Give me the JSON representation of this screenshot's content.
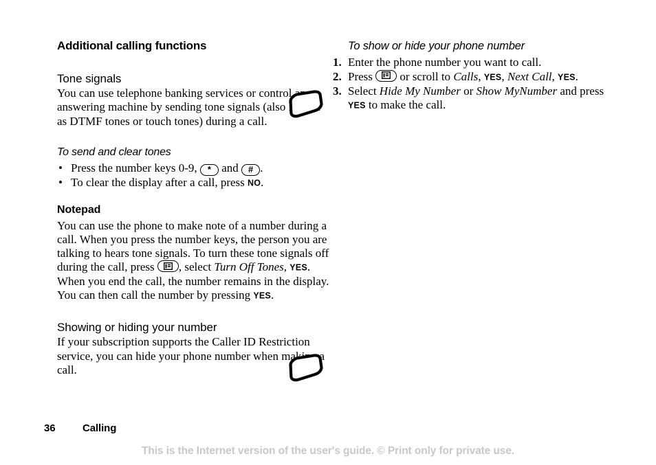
{
  "document": {
    "title": "Additional calling functions",
    "footer": {
      "page_number": "36",
      "chapter": "Calling"
    },
    "watermark": "This is the Internet version of the user's guide. © Print only for private use."
  },
  "left_column": {
    "tone_signals": {
      "heading": "Tone signals",
      "body": "You can use telephone banking services or control an answering machine by sending tone signals (also known as DTMF tones or touch tones) during a call."
    },
    "send_clear_tones": {
      "heading": "To send and clear tones",
      "bullets": [
        {
          "marker": "•",
          "part1": "Press the number keys 0-9,",
          "key1": "*",
          "part2": "and",
          "key2": "#",
          "part3": "."
        },
        {
          "marker": "•",
          "part1": "To clear the display after a call, press",
          "softkey": "NO",
          "part2": "."
        }
      ]
    },
    "notepad": {
      "heading": "Notepad",
      "part1": "You can use the phone to make note of a number during a call. When you press the number keys, the person you are talking to hears tone signals. To turn these tone signals off during the call, press",
      "part2": ", select",
      "menu_item": "Turn Off Tones",
      "part3": ",",
      "softkey1": "YES",
      "part4": ". When you end the call, the number remains in the display. You can then call the number by pressing",
      "softkey2": "YES",
      "part5": "."
    },
    "showing_hiding": {
      "heading": "Showing or hiding your number",
      "body": "If your subscription supports the Caller ID Restriction service, you can hide your phone number when making a call."
    }
  },
  "right_column": {
    "show_hide_number": {
      "heading": "To show or hide your phone number",
      "steps": [
        {
          "number": "1.",
          "part1": "Enter the phone number you want to call."
        },
        {
          "number": "2.",
          "part1": "Press",
          "part2": "or scroll to",
          "menu_item1": "Calls",
          "part3": ",",
          "softkey1": "YES",
          "part4": ",",
          "menu_item2": "Next Call",
          "part5": ",",
          "softkey2": "YES",
          "part6": "."
        },
        {
          "number": "3.",
          "part1": "Select",
          "menu_item1": "Hide My Number",
          "part2": "or",
          "menu_item2": "Show MyNumber",
          "part3": "and press",
          "softkey1": "YES",
          "part4": "to make the call."
        }
      ]
    }
  },
  "icons": {
    "menu_key": "menu-key-icon",
    "star_key": "star-key-icon",
    "hash_key": "hash-key-icon",
    "phone_tone": "phone-icon",
    "phone_showhide": "phone-icon"
  }
}
